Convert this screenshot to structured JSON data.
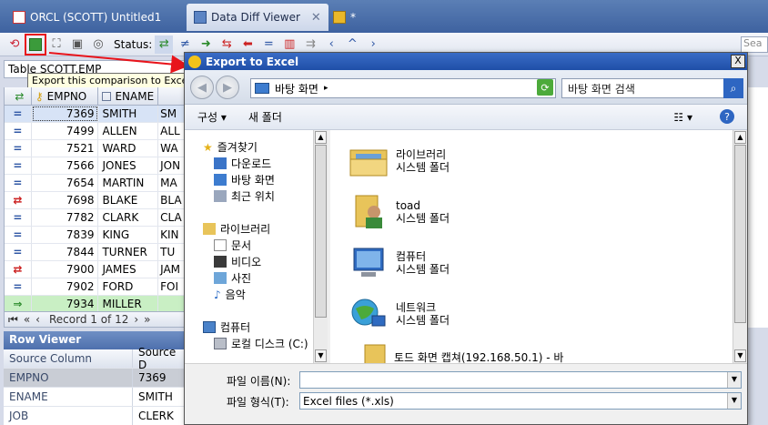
{
  "tabs": [
    {
      "label": "ORCL (SCOTT)  Untitled1"
    },
    {
      "label": "Data Diff Viewer",
      "close": "✕"
    },
    {
      "label": "*"
    }
  ],
  "toolbar": {
    "status_label": "Status:",
    "search_placeholder": "Sea"
  },
  "table_title": "Table SCOTT.EMP",
  "tooltip": "Export this comparison to Excel",
  "grid": {
    "headers": [
      "EMPNO",
      "ENAME"
    ],
    "rows": [
      {
        "status": "=",
        "empno": "7369",
        "ename": "SMITH",
        "extra": "SM"
      },
      {
        "status": "=",
        "empno": "7499",
        "ename": "ALLEN",
        "extra": "ALL"
      },
      {
        "status": "=",
        "empno": "7521",
        "ename": "WARD",
        "extra": "WA"
      },
      {
        "status": "=",
        "empno": "7566",
        "ename": "JONES",
        "extra": "JON"
      },
      {
        "status": "=",
        "empno": "7654",
        "ename": "MARTIN",
        "extra": "MA"
      },
      {
        "status": "⇄",
        "empno": "7698",
        "ename": "BLAKE",
        "extra": "BLA"
      },
      {
        "status": "=",
        "empno": "7782",
        "ename": "CLARK",
        "extra": "CLA"
      },
      {
        "status": "=",
        "empno": "7839",
        "ename": "KING",
        "extra": "KIN"
      },
      {
        "status": "=",
        "empno": "7844",
        "ename": "TURNER",
        "extra": "TU"
      },
      {
        "status": "⇄",
        "empno": "7900",
        "ename": "JAMES",
        "extra": "JAM"
      },
      {
        "status": "=",
        "empno": "7902",
        "ename": "FORD",
        "extra": "FOI"
      },
      {
        "status": "⇒",
        "empno": "7934",
        "ename": "MILLER",
        "extra": ""
      }
    ],
    "record_text": "Record 1 of 12"
  },
  "row_viewer": {
    "title": "Row Viewer",
    "col_source_column": "Source Column",
    "col_source_data": "Source D",
    "rows": [
      {
        "k": "EMPNO",
        "v": "7369"
      },
      {
        "k": "ENAME",
        "v": "SMITH"
      },
      {
        "k": "JOB",
        "v": "CLERK"
      }
    ]
  },
  "dialog": {
    "title": "Export to Excel",
    "close": "X",
    "location": "바탕 화면",
    "search_placeholder": "바탕 화면 검색",
    "cmd_organize": "구성 ▾",
    "cmd_new_folder": "새 폴더",
    "nav": {
      "favorites": "즐겨찾기",
      "downloads": "다운로드",
      "desktop": "바탕 화면",
      "recent": "최근 위치",
      "libraries": "라이브러리",
      "documents": "문서",
      "videos": "비디오",
      "pictures": "사진",
      "music": "음악",
      "computer": "컴퓨터",
      "local_disk": "로컬 디스크 (C:)"
    },
    "files": [
      {
        "name": "라이브러리",
        "type": "시스템 폴더",
        "icon": "library-folder-icon"
      },
      {
        "name": "toad",
        "type": "시스템 폴더",
        "icon": "user-folder-icon"
      },
      {
        "name": "컴퓨터",
        "type": "시스템 폴더",
        "icon": "computer-icon"
      },
      {
        "name": "네트워크",
        "type": "시스템 폴더",
        "icon": "network-icon"
      },
      {
        "name": "토드 화면 캡쳐(192.168.50.1) - 바",
        "type": "",
        "icon": "folder-icon"
      }
    ],
    "filename_label": "파일 이름(N):",
    "filename_value": "",
    "filetype_label": "파일 형식(T):",
    "filetype_value": "Excel files (*.xls)"
  },
  "colors": {
    "accent_red": "#e8141b",
    "title_blue": "#1f4fa8"
  }
}
